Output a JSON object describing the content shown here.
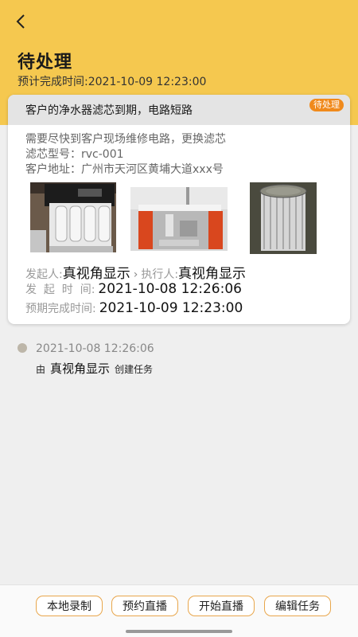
{
  "header": {
    "title": "待处理",
    "subtitle": "预计完成时间:2021-10-09 12:23:00",
    "back_icon": "chevron-left-icon",
    "background_color": "#f5c84f"
  },
  "task": {
    "title": "客户的净水器滤芯到期，电路短路",
    "status": "待处理",
    "status_color": "#f08a1c",
    "description": "需要尽快到客户现场维修电路，更换滤芯",
    "filter_model": "滤芯型号：rvc-001",
    "address": "客户地址：广州市天河区黄埔大道xxx号",
    "images": [
      "water-purifier-photo",
      "sink-cabinet-photo",
      "filter-cartridge-photo"
    ],
    "initiator_label": "发起人:",
    "initiator": "真视角显示",
    "executor_label": "执行人:",
    "executor": "真视角显示",
    "start_label": "发  起  时  间:",
    "start_time": "2021-10-08 12:26:06",
    "due_label": "预期完成时间:",
    "due_time": "2021-10-09 12:23:00"
  },
  "timeline": {
    "time": "2021-10-08 12:26:06",
    "by": "由",
    "user": "真视角显示",
    "action": "创建任务"
  },
  "actions": {
    "local_record": "本地录制",
    "schedule_live": "预约直播",
    "start_live": "开始直播",
    "edit_task": "编辑任务"
  }
}
